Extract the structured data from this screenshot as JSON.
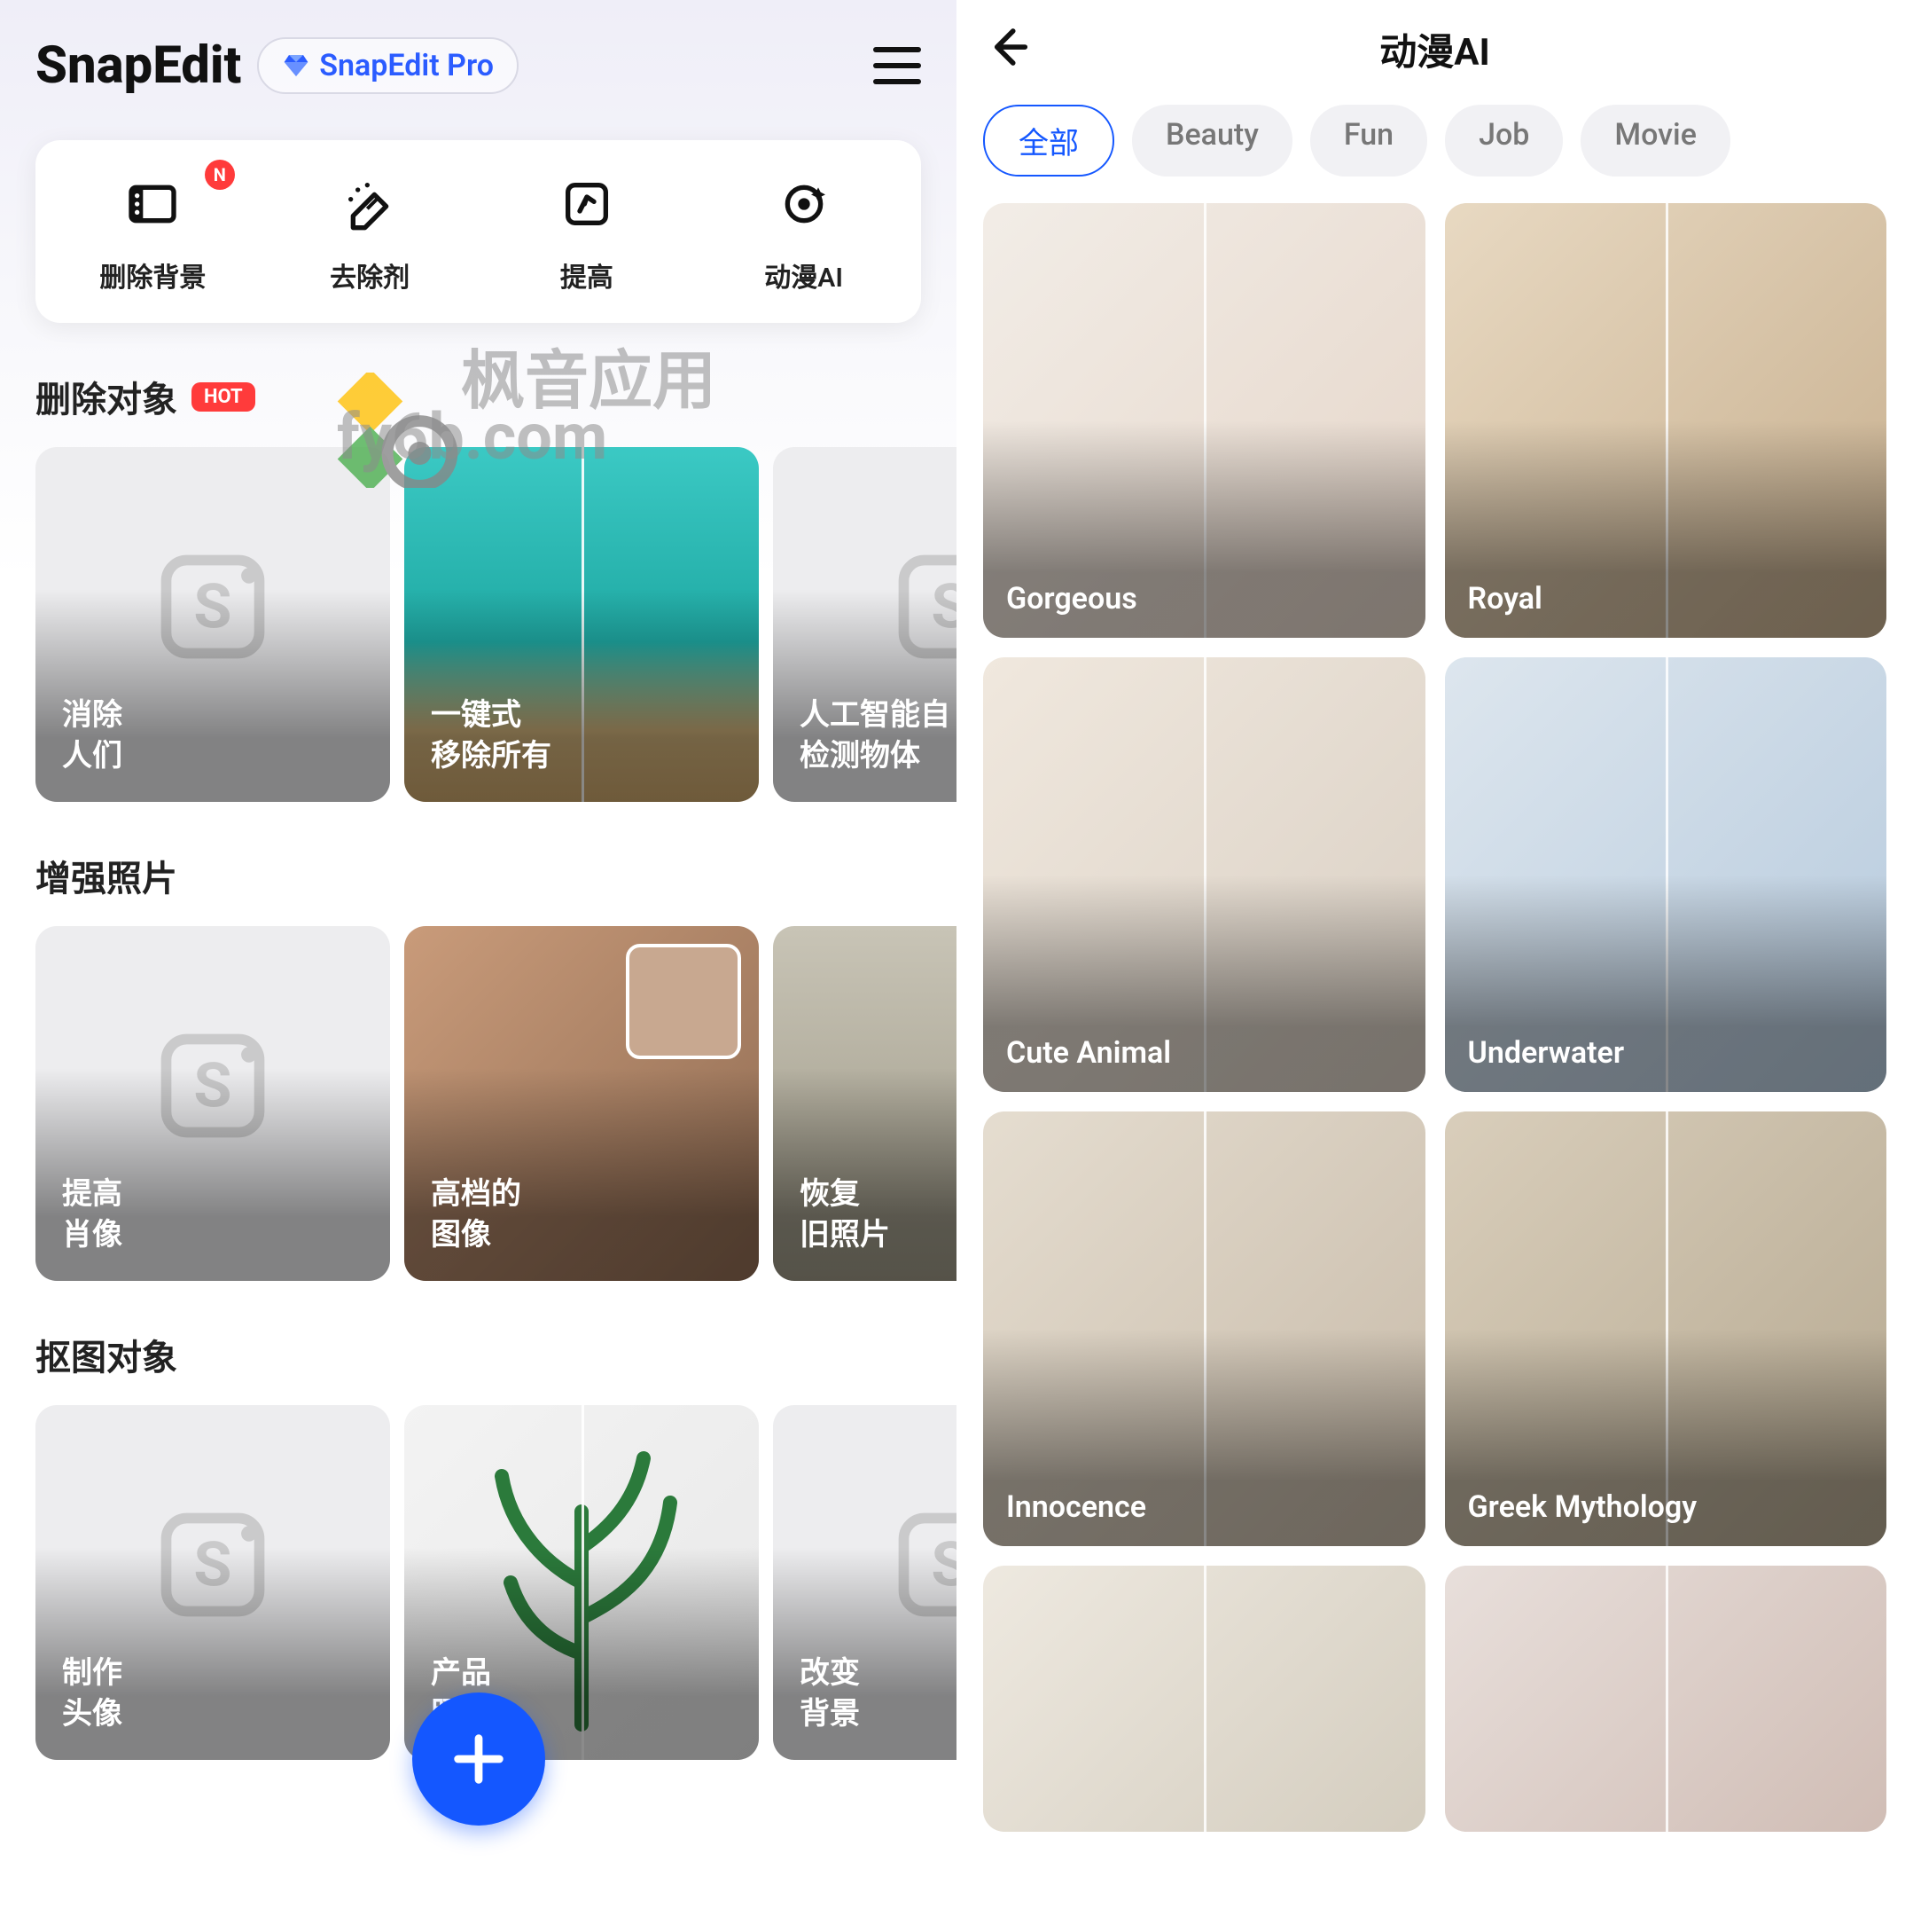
{
  "left": {
    "header": {
      "title": "SnapEdit",
      "pro_label": "SnapEdit Pro"
    },
    "tools": [
      {
        "label": "删除背景",
        "new": "N"
      },
      {
        "label": "去除剂"
      },
      {
        "label": "提高"
      },
      {
        "label": "动漫AI"
      }
    ],
    "watermark_cn": "枫音应用",
    "watermark_url": "fy6b.com",
    "sections": [
      {
        "title": "删除对象",
        "badge": "HOT",
        "cards": [
          {
            "line1": "消除",
            "line2": "人们"
          },
          {
            "line1": "一键式",
            "line2": "移除所有"
          },
          {
            "line1": "人工智能自",
            "line2": "检测物体"
          }
        ]
      },
      {
        "title": "增强照片",
        "cards": [
          {
            "line1": "提高",
            "line2": "肖像"
          },
          {
            "line1": "高档的",
            "line2": "图像"
          },
          {
            "line1": "恢复",
            "line2": "旧照片"
          }
        ]
      },
      {
        "title": "抠图对象",
        "cards": [
          {
            "line1": "制作",
            "line2": "头像"
          },
          {
            "line1": "产品",
            "line2": "照片"
          },
          {
            "line1": "改变",
            "line2": "背景"
          }
        ]
      }
    ]
  },
  "right": {
    "title": "动漫AI",
    "chips": [
      "全部",
      "Beauty",
      "Fun",
      "Job",
      "Movie"
    ],
    "active_chip_index": 0,
    "styles": [
      "Gorgeous",
      "Royal",
      "Cute Animal",
      "Underwater",
      "Innocence",
      "Greek Mythology"
    ]
  }
}
